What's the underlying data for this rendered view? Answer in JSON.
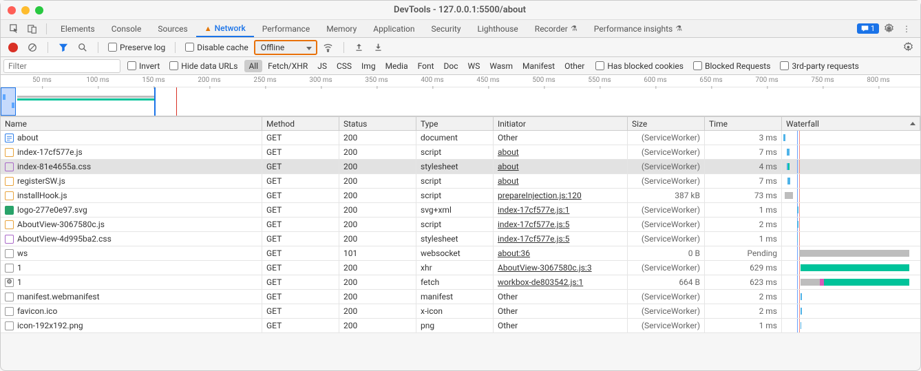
{
  "window": {
    "title": "DevTools - 127.0.0.1:5500/about"
  },
  "tabs": {
    "items": [
      "Elements",
      "Console",
      "Sources",
      "Network",
      "Performance",
      "Memory",
      "Application",
      "Security",
      "Lighthouse",
      "Recorder",
      "Performance insights"
    ],
    "active": "Network",
    "warnTab": "Network",
    "expTabs": [
      "Recorder",
      "Performance insights"
    ],
    "messages": "1"
  },
  "toolbar": {
    "preserve_log": "Preserve log",
    "disable_cache": "Disable cache",
    "throttling": "Offline"
  },
  "filter": {
    "placeholder": "Filter",
    "invert": "Invert",
    "hide_data_urls": "Hide data URLs",
    "types": [
      "All",
      "Fetch/XHR",
      "JS",
      "CSS",
      "Img",
      "Media",
      "Font",
      "Doc",
      "WS",
      "Wasm",
      "Manifest",
      "Other"
    ],
    "active_type": "All",
    "has_blocked_cookies": "Has blocked cookies",
    "blocked_requests": "Blocked Requests",
    "third_party": "3rd-party requests"
  },
  "overview": {
    "ticks": [
      "50 ms",
      "100 ms",
      "150 ms",
      "200 ms",
      "250 ms",
      "300 ms",
      "350 ms",
      "400 ms",
      "450 ms",
      "500 ms",
      "550 ms",
      "600 ms",
      "650 ms",
      "700 ms",
      "750 ms",
      "800 ms"
    ]
  },
  "cols": {
    "name": "Name",
    "method": "Method",
    "status": "Status",
    "type": "Type",
    "initiator": "Initiator",
    "size": "Size",
    "time": "Time",
    "waterfall": "Waterfall"
  },
  "rows": [
    {
      "icon": "doc",
      "name": "about",
      "method": "GET",
      "status": "200",
      "type": "document",
      "initiator": "Other",
      "init_link": false,
      "size": "(ServiceWorker)",
      "time": "3 ms",
      "wf": [
        {
          "cls": "wf-blue",
          "l": 2,
          "w": 3
        }
      ]
    },
    {
      "icon": "js",
      "name": "index-17cf577e.js",
      "method": "GET",
      "status": "200",
      "type": "script",
      "initiator": "about",
      "init_link": true,
      "size": "(ServiceWorker)",
      "time": "7 ms",
      "wf": [
        {
          "cls": "wf-blue",
          "l": 7,
          "w": 4
        }
      ]
    },
    {
      "icon": "css",
      "name": "index-81e4655a.css",
      "method": "GET",
      "status": "200",
      "type": "stylesheet",
      "initiator": "about",
      "init_link": true,
      "size": "(ServiceWorker)",
      "time": "4 ms",
      "wf": [
        {
          "cls": "wf-blue",
          "l": 7,
          "w": 2
        },
        {
          "cls": "wf-green",
          "l": 9,
          "w": 2
        }
      ],
      "sel": true
    },
    {
      "icon": "js",
      "name": "registerSW.js",
      "method": "GET",
      "status": "200",
      "type": "script",
      "initiator": "about",
      "init_link": true,
      "size": "(ServiceWorker)",
      "time": "7 ms",
      "wf": [
        {
          "cls": "wf-blue",
          "l": 8,
          "w": 4
        }
      ]
    },
    {
      "icon": "js",
      "name": "installHook.js",
      "method": "GET",
      "status": "200",
      "type": "script",
      "initiator": "prepareInjection.js:120",
      "init_link": true,
      "size": "387 kB",
      "time": "73 ms",
      "wf": [
        {
          "cls": "wf-grey",
          "l": 4,
          "w": 12
        }
      ]
    },
    {
      "icon": "img",
      "name": "logo-277e0e97.svg",
      "method": "GET",
      "status": "200",
      "type": "svg+xml",
      "initiator": "index-17cf577e.js:1",
      "init_link": true,
      "size": "(ServiceWorker)",
      "time": "1 ms",
      "wf": [
        {
          "cls": "wf-blue",
          "l": 22,
          "w": 2
        }
      ]
    },
    {
      "icon": "js",
      "name": "AboutView-3067580c.js",
      "method": "GET",
      "status": "200",
      "type": "script",
      "initiator": "index-17cf577e.js:5",
      "init_link": true,
      "size": "(ServiceWorker)",
      "time": "2 ms",
      "wf": [
        {
          "cls": "wf-blue",
          "l": 22,
          "w": 2
        }
      ]
    },
    {
      "icon": "css",
      "name": "AboutView-4d995ba2.css",
      "method": "GET",
      "status": "200",
      "type": "stylesheet",
      "initiator": "index-17cf577e.js:5",
      "init_link": true,
      "size": "(ServiceWorker)",
      "time": "1 ms",
      "wf": [
        {
          "cls": "wf-blue",
          "l": 22,
          "w": 1
        }
      ]
    },
    {
      "icon": "other",
      "name": "ws",
      "method": "GET",
      "status": "101",
      "type": "websocket",
      "initiator": "about:36",
      "init_link": true,
      "size": "0 B",
      "time": "Pending",
      "wf": [
        {
          "cls": "wf-grey",
          "l": 25,
          "w": 160
        }
      ]
    },
    {
      "icon": "other",
      "name": "1",
      "method": "GET",
      "status": "200",
      "type": "xhr",
      "initiator": "AboutView-3067580c.js:3",
      "init_link": true,
      "size": "(ServiceWorker)",
      "time": "629 ms",
      "wf": [
        {
          "cls": "wf-green",
          "l": 27,
          "w": 158
        }
      ]
    },
    {
      "icon": "gear",
      "name": "1",
      "method": "GET",
      "status": "200",
      "type": "fetch",
      "initiator": "workbox-de803542.js:1",
      "init_link": true,
      "size": "664 B",
      "time": "623 ms",
      "wf": [
        {
          "cls": "wf-grey",
          "l": 27,
          "w": 28
        },
        {
          "cls": "wf-pink",
          "l": 55,
          "w": 6
        },
        {
          "cls": "wf-green",
          "l": 61,
          "w": 124
        }
      ]
    },
    {
      "icon": "other",
      "name": "manifest.webmanifest",
      "method": "GET",
      "status": "200",
      "type": "manifest",
      "initiator": "Other",
      "init_link": false,
      "size": "(ServiceWorker)",
      "time": "2 ms",
      "wf": [
        {
          "cls": "wf-blue",
          "l": 27,
          "w": 2
        }
      ]
    },
    {
      "icon": "other",
      "name": "favicon.ico",
      "method": "GET",
      "status": "200",
      "type": "x-icon",
      "initiator": "Other",
      "init_link": false,
      "size": "(ServiceWorker)",
      "time": "2 ms",
      "wf": [
        {
          "cls": "wf-blue",
          "l": 27,
          "w": 2
        }
      ]
    },
    {
      "icon": "other",
      "name": "icon-192x192.png",
      "method": "GET",
      "status": "200",
      "type": "png",
      "initiator": "Other",
      "init_link": false,
      "size": "(ServiceWorker)",
      "time": "1 ms",
      "wf": [
        {
          "cls": "wf-blue",
          "l": 27,
          "w": 1
        }
      ]
    }
  ]
}
